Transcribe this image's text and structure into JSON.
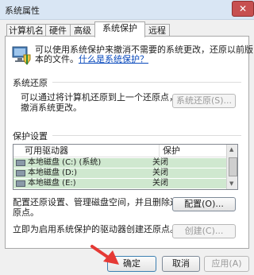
{
  "window": {
    "title": "系统属性",
    "close_label": "✕"
  },
  "tabs": [
    {
      "label": "计算机名",
      "active": false
    },
    {
      "label": "硬件",
      "active": false
    },
    {
      "label": "高级",
      "active": false
    },
    {
      "label": "系统保护",
      "active": true
    },
    {
      "label": "远程",
      "active": false
    }
  ],
  "intro": {
    "line1": "可以使用系统保护来撤消不需要的系统更改，还原以前版",
    "line2_prefix": "本的文件。",
    "link": "什么是系统保护？"
  },
  "restore": {
    "title": "系统还原",
    "desc_line1": "可以通过将计算机还原到上一个还原点，",
    "desc_line2": "撤消系统更改。",
    "button": "系统还原(S)..."
  },
  "protection": {
    "title": "保护设置",
    "columns": [
      "可用驱动器",
      "保护"
    ],
    "rows": [
      {
        "drive": "本地磁盘 (C:) (系统)",
        "status": "关闭"
      },
      {
        "drive": "本地磁盘 (D:)",
        "status": "关闭"
      },
      {
        "drive": "本地磁盘 (E:)",
        "status": "关闭"
      }
    ],
    "configure_line1": "配置还原设置、管理磁盘空间，并且删除还",
    "configure_line2": "原点。",
    "configure_button": "配置(O)...",
    "create_line1": "立即为启用系统保护的驱动器创建还原点。",
    "create_button": "创建(C)..."
  },
  "footer": {
    "ok": "确定",
    "cancel": "取消",
    "apply": "应用(A)"
  },
  "colors": {
    "row_highlight": "#cfe8cf",
    "arrow": "#e53935",
    "link": "#0b4bbd"
  }
}
